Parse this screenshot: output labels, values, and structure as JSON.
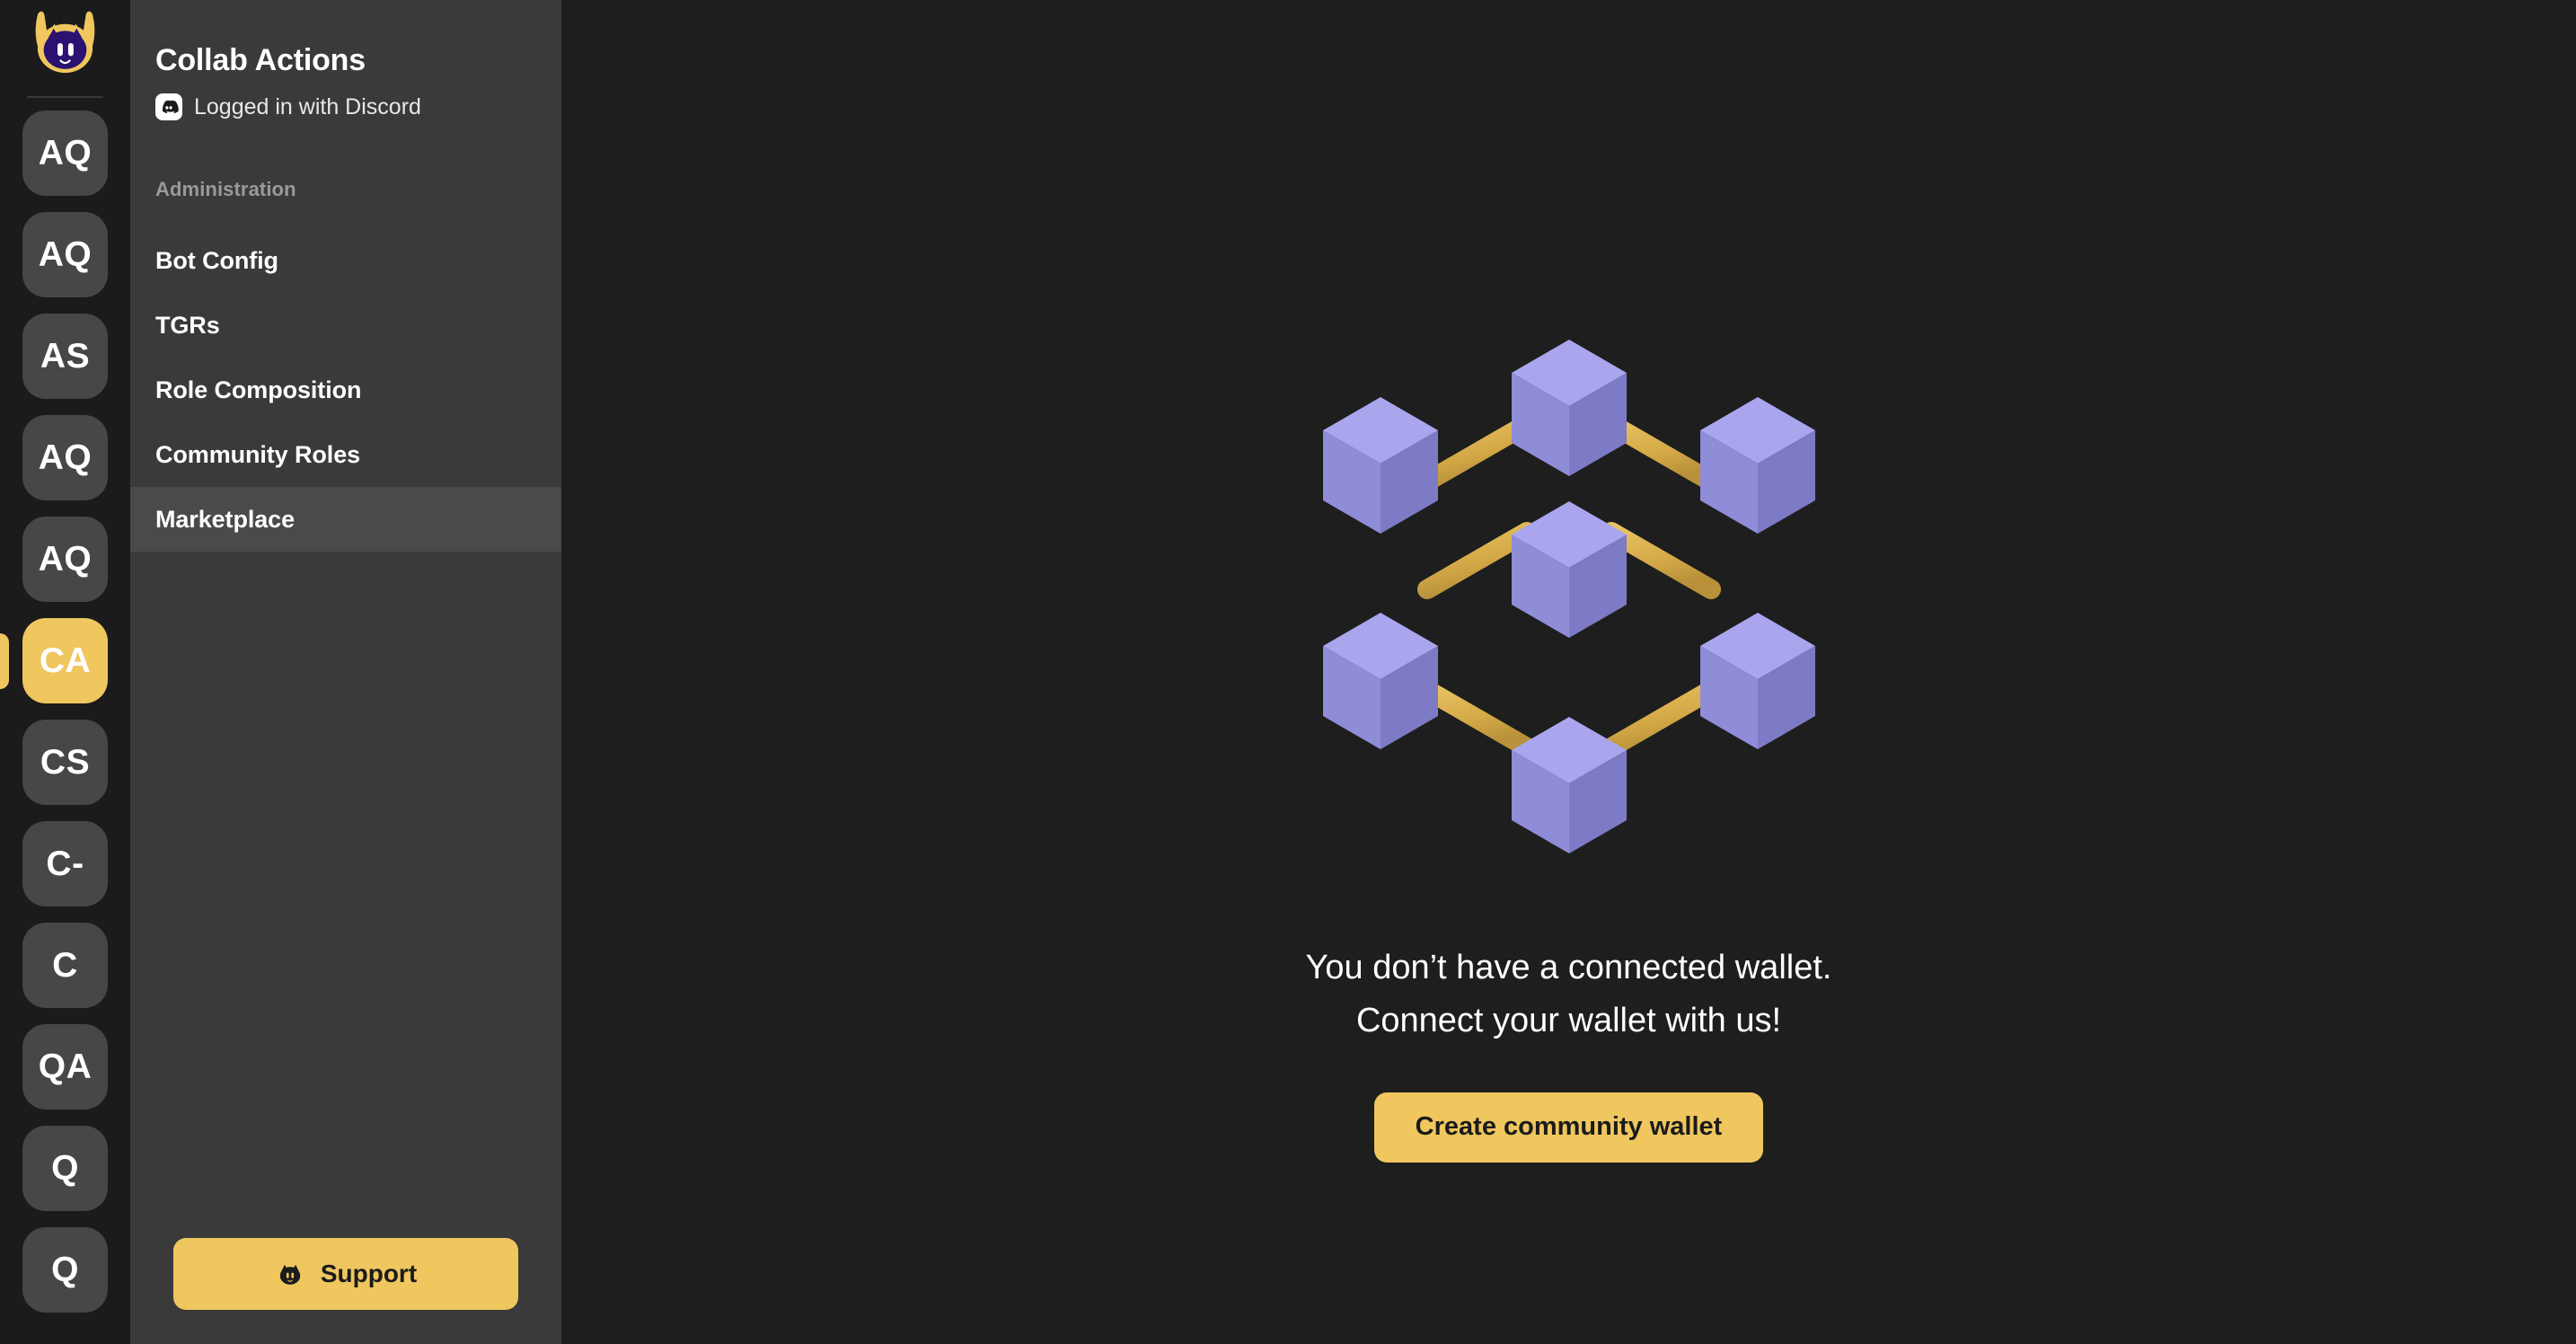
{
  "rail": {
    "logo_icon": "collabland-mascot-logo",
    "active_index": 5,
    "items": [
      {
        "label": "AQ",
        "active": false
      },
      {
        "label": "AQ",
        "active": false
      },
      {
        "label": "AS",
        "active": false
      },
      {
        "label": "AQ",
        "active": false
      },
      {
        "label": "AQ",
        "active": false
      },
      {
        "label": "CA",
        "active": true
      },
      {
        "label": "CS",
        "active": false
      },
      {
        "label": "C-",
        "active": false
      },
      {
        "label": "C",
        "active": false
      },
      {
        "label": "QA",
        "active": false
      },
      {
        "label": "Q",
        "active": false
      },
      {
        "label": "Q",
        "active": false
      }
    ]
  },
  "nav": {
    "title": "Collab Actions",
    "login_status": "Logged in with Discord",
    "login_icon": "discord-icon",
    "section_label": "Administration",
    "items": [
      {
        "label": "Bot Config",
        "active": false
      },
      {
        "label": "TGRs",
        "active": false
      },
      {
        "label": "Role Composition",
        "active": false
      },
      {
        "label": "Community Roles",
        "active": false
      },
      {
        "label": "Marketplace",
        "active": true
      }
    ],
    "support_label": "Support",
    "support_icon": "collabland-mascot-icon"
  },
  "main": {
    "illustration": "blockchain-network-cubes",
    "empty_line_1": "You don’t have a connected wallet.",
    "empty_line_2": "Connect your wallet with us!",
    "cta_label": "Create community wallet"
  },
  "colors": {
    "accent_gold": "#EFC75E",
    "rail_bg": "#1B1B1B",
    "nav_bg": "#3A3A3A",
    "nav_active_bg": "#4A4A4A",
    "main_bg": "#1E1E1E",
    "tile_bg": "#474747",
    "cube_top": "#A9A6EE",
    "cube_left": "#8F8CD8",
    "cube_right": "#7D7AC6",
    "rod": "#D9B14A"
  }
}
